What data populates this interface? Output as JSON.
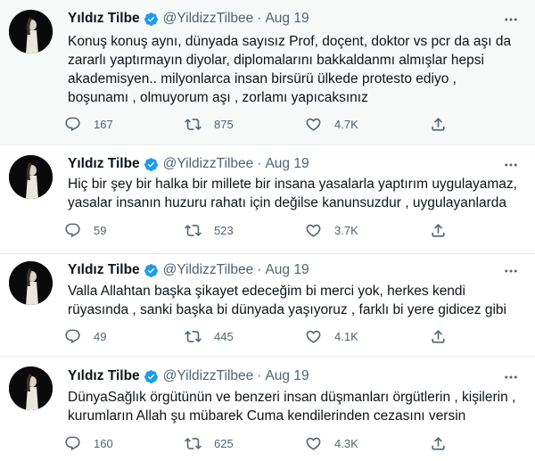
{
  "tweets": [
    {
      "name": "Yıldız Tilbe",
      "handle": "@YildizzTilbee",
      "sep": "·",
      "date": "Aug 19",
      "text": "Konuş konuş aynı, dünyada sayısız Prof, doçent, doktor vs pcr da aşı da zararlı yaptırmayın diyolar, diplomalarını bakkaldanmı almışlar hepsi akademisyen.. milyonlarca insan birsürü ülkede protesto ediyo , boşunamı , olmuyorum aşı , zorlamı yapıcaksınız",
      "replies": "167",
      "retweets": "875",
      "likes": "4.7K"
    },
    {
      "name": "Yıldız Tilbe",
      "handle": "@YildizzTilbee",
      "sep": "·",
      "date": "Aug 19",
      "text": "Hiç bir şey bir halka bir millete bir insana yasalarla yaptırım uygulayamaz, yasalar insanın huzuru rahatı için değilse kanunsuzdur , uygulayanlarda",
      "replies": "59",
      "retweets": "523",
      "likes": "3.7K"
    },
    {
      "name": "Yıldız Tilbe",
      "handle": "@YildizzTilbee",
      "sep": "·",
      "date": "Aug 19",
      "text": "Valla Allahtan başka şikayet edeceğim bi merci yok, herkes kendi rüyasında , sanki başka bi dünyada yaşıyoruz , farklı bi yere gidicez gibi",
      "replies": "49",
      "retweets": "445",
      "likes": "4.1K"
    },
    {
      "name": "Yıldız Tilbe",
      "handle": "@YildizzTilbee",
      "sep": "·",
      "date": "Aug 19",
      "text": "DünyaSağlık örgütünün ve benzeri insan düşmanları örgütlerin , kişilerin , kurumların Allah şu mübarek Cuma kendilerinden cezasını versin",
      "replies": "160",
      "retweets": "625",
      "likes": "4.3K"
    }
  ],
  "colors": {
    "text": "#0f1419",
    "muted": "#536471",
    "verified": "#1d9bf0",
    "highlight_bg": "#f7f9f9"
  },
  "icons": [
    "verified-badge-icon",
    "more-icon",
    "reply-icon",
    "retweet-icon",
    "like-icon",
    "share-icon"
  ]
}
